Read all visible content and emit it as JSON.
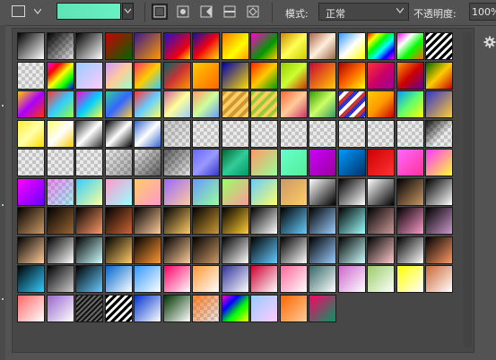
{
  "toolbar": {
    "mode_label": "模式:",
    "mode_value": "正常",
    "opacity_label": "不透明度:",
    "opacity_value": "100%",
    "current_gradient": [
      "#5de3b4",
      "#69f0c4"
    ],
    "gradient_types": [
      "linear",
      "radial",
      "angle",
      "reflected",
      "diamond"
    ],
    "active_gradient_type": "linear"
  },
  "icons": {
    "tool_preset": "gradient-tool-preset-icon",
    "settings": "gear-icon"
  },
  "presets": [
    [
      "linear-gradient(135deg,#000 0%,#fff 100%)",
      "checker:linear-gradient(135deg,#000 0%,rgba(0,0,0,0) 100%)",
      "linear-gradient(135deg,#000 0%,#fff 100%)",
      "linear-gradient(135deg,#c00 0%,#060 100%)",
      "linear-gradient(135deg,#3a1a8a 0%,#f90 100%)",
      "linear-gradient(135deg,#21c 0%,#e01 70%,#fd0 100%)",
      "linear-gradient(135deg,#11a 0%,#e01 50%,#fd0 100%)",
      "linear-gradient(135deg,#f70 0%,#ff0 60%,#f90 100%)",
      "linear-gradient(135deg,#f0c 0%,#090 60%,#fc0 100%)",
      "linear-gradient(135deg,#c80 0%,#ff5 50%,#cc0 100%)",
      "linear-gradient(135deg,#a64 0%,#fed 50%,#964 100%)",
      "linear-gradient(135deg,#39f 0%,#fff 50%,#ff0 100%)",
      "linear-gradient(135deg,#f00 0%,#ff0 20%,#0f0 40%,#0ff 60%,#00f 80%,#f0f 100%)",
      "linear-gradient(135deg,#f0f 0%,#fff 30%,#0f0 60%,#f60 100%)",
      "repeating-linear-gradient(135deg,#000 0 3px,#fff 3px 6px)"
    ],
    [
      "checker:",
      "linear-gradient(135deg,#f0f 0%,#f00 25%,#ff0 50%,#0f0 75%,#00f 100%)",
      "linear-gradient(135deg,#9cf 0%,#fcf 100%)",
      "linear-gradient(135deg,#c9f 0%,#fc9 50%,#9fc 100%)",
      "linear-gradient(135deg,#f36 0%,#fc0 50%,#3cf 100%)",
      "linear-gradient(135deg,#066 0%,#c33 50%,#f90 100%)",
      "linear-gradient(135deg,#fc0 0%,#f60 100%)",
      "linear-gradient(135deg,#00a 0%,#fd0 100%)",
      "linear-gradient(135deg,#f20 0%,#fc0 50%,#090 100%)",
      "linear-gradient(135deg,#9c0 0%,#cf3 50%,#c30 100%)",
      "linear-gradient(135deg,#c03 0%,#fc0 100%)",
      "linear-gradient(135deg,#a00 0%,#f60 50%,#ff0 100%)",
      "linear-gradient(135deg,#f33 0%,#c06 50%,#909 100%)",
      "linear-gradient(135deg,#f90 0%,#c00 50%,#609 100%)",
      "linear-gradient(135deg,#060 0%,#fc0 50%,#c00 100%)"
    ],
    [
      "linear-gradient(135deg,#fc0 0%,#a0f 50%,#f30 100%)",
      "linear-gradient(135deg,#f33 0%,#3cf 50%,#9f3 100%)",
      "linear-gradient(135deg,#f0c 0%,#0cf 50%,#ff3 100%)",
      "linear-gradient(135deg,#3c9 0%,#36f 50%,#fc3 100%)",
      "linear-gradient(135deg,#f33 0%,#6cf 50%,#ff6 100%)",
      "linear-gradient(135deg,#c69 0%,#ff9 50%,#9cf 100%)",
      "linear-gradient(135deg,#f96 0%,#cf9 50%,#69f 100%)",
      "repeating-linear-gradient(135deg,#c93 0 4px,#fc6 4px 8px)",
      "repeating-linear-gradient(135deg,#9c3 0 4px,#fc6 4px 8px)",
      "linear-gradient(135deg,#f63 0%,#fc9 50%,#c36 100%)",
      "linear-gradient(135deg,#390 0%,#cf6 50%,#396 100%)",
      "repeating-linear-gradient(135deg,#33c 0 4px,#fff 4px 8px,#c33 8px 12px)",
      "linear-gradient(135deg,#fc0 0%,#f90 50%,#c00 100%)",
      "linear-gradient(135deg,#09f 0%,#6f6 50%,#ff0 100%)",
      "linear-gradient(135deg,#33c 0%,#fc3 100%)"
    ],
    [
      "linear-gradient(135deg,#fe3 0%,#ffa 50%,#fd0 100%)",
      "linear-gradient(135deg,#ff6 0%,#fff 50%,#fc0 100%)",
      "linear-gradient(135deg,#333 0%,#fff 50%,#333 100%)",
      "linear-gradient(135deg,#000 0%,#fff 50%,#000 100%)",
      "linear-gradient(135deg,#36c 0%,#fff 50%,#36c 100%)",
      "checker:linear-gradient(135deg,rgba(0,0,0,0.15),rgba(0,0,0,0))",
      "checker:",
      "checker:",
      "checker:",
      "checker:",
      "checker:",
      "checker:",
      "checker:",
      "checker:",
      "checker:linear-gradient(135deg,rgba(0,0,0,0.9) 0%,rgba(0,0,0,0) 60%)"
    ],
    [
      "checker:",
      "checker:",
      "checker:",
      "checker:linear-gradient(135deg,rgba(0,0,0,0),rgba(0,0,0,0.3))",
      "checker:linear-gradient(135deg,rgba(0,0,0,0),rgba(0,0,0,0.6))",
      "checker:linear-gradient(135deg,rgba(0,0,0,0.6),rgba(0,0,0,0))",
      "linear-gradient(135deg,#66f 0%,#99f 50%,#33c 100%)",
      "linear-gradient(135deg,#063 0%,#3c9 50%,#096 100%)",
      "linear-gradient(135deg,#f96 0%,#9f9 100%)",
      "linear-gradient(135deg,#6fc 0%,#5e9 100%)",
      "linear-gradient(135deg,#c0f 0%,#909 100%)",
      "linear-gradient(135deg,#09f 0%,#036 100%)",
      "linear-gradient(135deg,#c00 0%,#f33 100%)",
      "linear-gradient(135deg,#f6f 0%,#f39 100%)",
      "linear-gradient(135deg,#f3f 0%,#ff3 100%)"
    ],
    [
      "linear-gradient(135deg,#f0f 0%,#60f 100%)",
      "checker:linear-gradient(135deg,rgba(255,0,255,0.4),rgba(0,255,255,0.3))",
      "linear-gradient(135deg,#3cf 0%,#ff9 100%)",
      "linear-gradient(135deg,#f9c 0%,#9ff 100%)",
      "linear-gradient(135deg,#fc6 0%,#f9c 100%)",
      "linear-gradient(135deg,#96f 0%,#fc9 100%)",
      "linear-gradient(135deg,#69f 0%,#9f9 100%)",
      "linear-gradient(135deg,#9f6 0%,#f99 100%)",
      "linear-gradient(135deg,#6cf 0%,#ff6 100%)",
      "linear-gradient(135deg,#c96 0%,#fc6 100%)",
      "linear-gradient(135deg,#fff 0%,#000 100%)",
      "linear-gradient(135deg,#000 0%,#fff 100%)",
      "linear-gradient(135deg,#fff 0%,#000 100%)",
      "linear-gradient(135deg,#000 0%,#c96 100%)",
      "linear-gradient(135deg,#000 0%,#fff 100%)"
    ],
    [
      "linear-gradient(135deg,#000 0%,#c96 100%)",
      "linear-gradient(135deg,#000 0%,#963 100%)",
      "linear-gradient(135deg,#000 0%,#f96 100%)",
      "linear-gradient(135deg,#000 0%,#c63 100%)",
      "linear-gradient(135deg,#000 0%,#fc9 100%)",
      "linear-gradient(135deg,#000 0%,#fc6 100%)",
      "linear-gradient(135deg,#000 0%,#c93 100%)",
      "linear-gradient(135deg,#000 0%,#fc3 100%)",
      "linear-gradient(135deg,#000 0%,#fff 100%)",
      "linear-gradient(135deg,#000 0%,#6cf 100%)",
      "linear-gradient(135deg,#000 0%,#9cf 100%)",
      "linear-gradient(135deg,#000 0%,#9ff 100%)",
      "linear-gradient(135deg,#000 0%,#c99 100%)",
      "linear-gradient(135deg,#000 0%,#f9c 100%)",
      "linear-gradient(135deg,#000 0%,#c9c 100%)"
    ],
    [
      "linear-gradient(135deg,#000 0%,#fc9 100%)",
      "linear-gradient(135deg,#000 0%,#fff 100%)",
      "linear-gradient(135deg,#000 0%,#cff 100%)",
      "linear-gradient(135deg,#000 0%,#fc6 100%)",
      "linear-gradient(135deg,#000 0%,#f93 100%)",
      "linear-gradient(135deg,#000 0%,#fc9 100%)",
      "linear-gradient(135deg,#000 0%,#c96 100%)",
      "linear-gradient(135deg,#000 0%,#fff 100%)",
      "linear-gradient(135deg,#000 0%,#6cf 100%)",
      "linear-gradient(135deg,#000 0%,#fff 100%)",
      "linear-gradient(135deg,#000 0%,#9cf 100%)",
      "linear-gradient(135deg,#000 0%,#cff 100%)",
      "linear-gradient(135deg,#000 0%,#fcc 100%)",
      "linear-gradient(135deg,#000 0%,#fff 100%)",
      "linear-gradient(135deg,#000 0%,#f96 100%)"
    ],
    [
      "linear-gradient(135deg,#000 0%,#3cf 100%)",
      "linear-gradient(135deg,#000 0%,#ccc 100%)",
      "linear-gradient(135deg,#000 0%,#6cf 100%)",
      "linear-gradient(135deg,#06c 0%,#fff 100%)",
      "linear-gradient(135deg,#39f 0%,#fff 100%)",
      "linear-gradient(135deg,#f06 0%,#fff 100%)",
      "linear-gradient(135deg,#f93 0%,#fff 100%)",
      "linear-gradient(135deg,#339 0%,#fff 100%)",
      "linear-gradient(135deg,#c03 0%,#fff 100%)",
      "linear-gradient(135deg,#f69 0%,#fff 100%)",
      "linear-gradient(135deg,#366 0%,#fff 100%)",
      "linear-gradient(135deg,#c6c 0%,#fff 100%)",
      "linear-gradient(135deg,#9c6 0%,#fff 100%)",
      "linear-gradient(135deg,#ff0 0%,#fff 100%)",
      "linear-gradient(135deg,#c63 0%,#fff 100%)"
    ],
    [
      "linear-gradient(135deg,#f66 0%,#fff 100%)",
      "linear-gradient(135deg,#96c 0%,#fff 100%)",
      "repeating-linear-gradient(135deg,#111 0 2px,#666 2px 4px)",
      "repeating-linear-gradient(135deg,#000 0 3px,#fff 3px 6px)",
      "linear-gradient(135deg,#03c 0%,#fff 100%)",
      "linear-gradient(135deg,#030 0%,#fff 100%)",
      "checker:linear-gradient(135deg,rgba(255,102,0,0.8),rgba(255,255,255,0))",
      "linear-gradient(135deg,#f0c 0%,#00f 30%,#0f0 60%,#ff0 100%)",
      "linear-gradient(135deg,#9cf 0%,#fcf 100%)",
      "linear-gradient(135deg,#f60 0%,#fc9 100%)",
      "linear-gradient(135deg,#f06 0%,#096 100%)"
    ]
  ]
}
